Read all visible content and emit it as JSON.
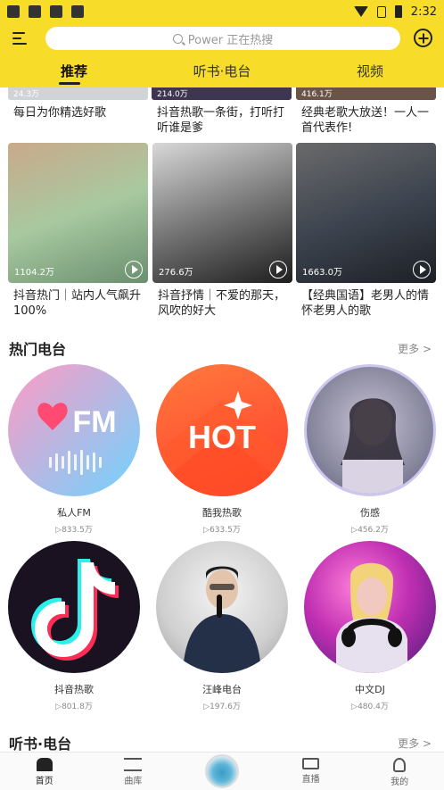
{
  "status_bar": {
    "time": "2:32"
  },
  "header": {
    "search_placeholder": "Power 正在热搜",
    "tabs": [
      {
        "label": "推荐",
        "active": true
      },
      {
        "label": "听书·电台",
        "active": false
      },
      {
        "label": "视频",
        "active": false
      }
    ]
  },
  "top_cards": [
    {
      "count": "24.3万",
      "title": "每日为你精选好歌"
    },
    {
      "count": "214.0万",
      "title": "抖音热歌一条街，打听打听谁是爹"
    },
    {
      "count": "416.1万",
      "title": "经典老歌大放送！一人一首代表作!"
    }
  ],
  "playlists": [
    {
      "count": "1104.2万",
      "title": "抖音热门｜站内人气飙升100%",
      "colors": [
        "#c9a98a",
        "#a8c9a0",
        "#6a8f6f"
      ]
    },
    {
      "count": "276.6万",
      "title": "抖音抒情｜不爱的那天，风吹的好大",
      "colors": [
        "#d8d8d8",
        "#777777",
        "#1e1e1e"
      ]
    },
    {
      "count": "1663.0万",
      "title": "【经典国语】老男人的情怀老男人的歌",
      "colors": [
        "#6a6a6a",
        "#3e4550",
        "#1c2026"
      ]
    }
  ],
  "radio_section": {
    "title": "热门电台",
    "more": "更多 >",
    "stations": [
      {
        "name": "私人FM",
        "plays": "▷833.5万",
        "style": "fm"
      },
      {
        "name": "酷我热歌",
        "plays": "▷633.5万",
        "style": "hot"
      },
      {
        "name": "伤感",
        "plays": "▷456.2万",
        "style": "sad"
      },
      {
        "name": "抖音热歌",
        "plays": "▷801.8万",
        "style": "tiktok"
      },
      {
        "name": "汪峰电台",
        "plays": "▷197.6万",
        "style": "singer"
      },
      {
        "name": "中文DJ",
        "plays": "▷480.4万",
        "style": "dj"
      }
    ]
  },
  "audiobook_section": {
    "title": "听书·电台",
    "more": "更多 >"
  },
  "bottom_nav": [
    {
      "label": "首页",
      "icon": "home-icon",
      "active": true
    },
    {
      "label": "曲库",
      "icon": "library-icon",
      "active": false
    },
    {
      "label": "",
      "icon": "now-playing-disc",
      "active": false
    },
    {
      "label": "直播",
      "icon": "live-camera-icon",
      "active": false
    },
    {
      "label": "我的",
      "icon": "profile-icon",
      "active": false
    }
  ],
  "logos": {
    "fm": "FM",
    "hot": "HOT"
  }
}
